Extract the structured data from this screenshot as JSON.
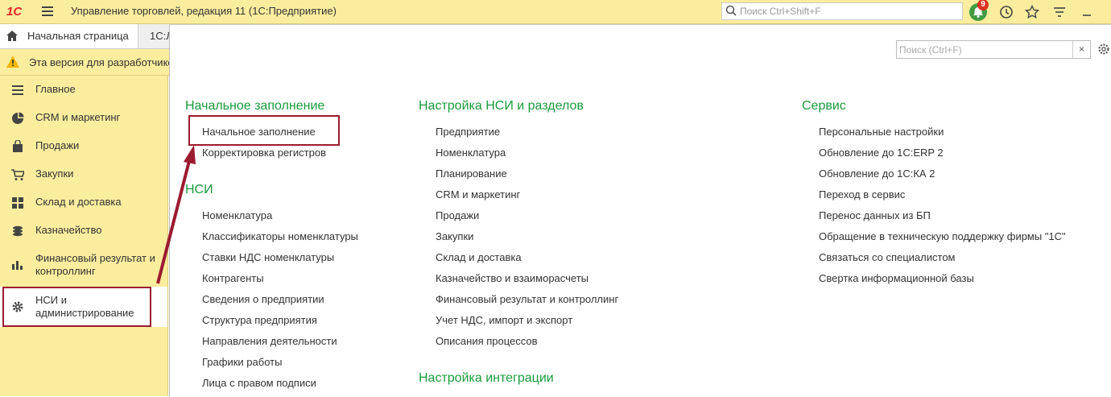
{
  "app": {
    "logo": "1С",
    "title": "Управление торговлей, редакция 11  (1С:Предприятие)",
    "search_placeholder": "Поиск Ctrl+Shift+F",
    "notification_count": "9"
  },
  "tabs": {
    "home": "Начальная страница",
    "next": "1С:Л"
  },
  "warning": "Эта версия для разработчико",
  "sidebar": {
    "items": [
      {
        "label": "Главное",
        "icon": "menu-lines-icon"
      },
      {
        "label": "CRM и маркетинг",
        "icon": "pie-chart-icon"
      },
      {
        "label": "Продажи",
        "icon": "shopping-bag-icon"
      },
      {
        "label": "Закупки",
        "icon": "cart-icon"
      },
      {
        "label": "Склад и доставка",
        "icon": "warehouse-grid-icon"
      },
      {
        "label": "Казначейство",
        "icon": "coins-icon"
      },
      {
        "label": "Финансовый результат и контроллинг",
        "icon": "bar-chart-icon"
      },
      {
        "label": "НСИ и администрирование",
        "icon": "gear-icon"
      }
    ]
  },
  "panel": {
    "search_placeholder": "Поиск (Ctrl+F)",
    "clear": "×",
    "sections": {
      "initial": {
        "title": "Начальное заполнение",
        "links": [
          "Начальное заполнение",
          "Корректировка регистров"
        ]
      },
      "nsi": {
        "title": "НСИ",
        "links": [
          "Номенклатура",
          "Классификаторы номенклатуры",
          "Ставки НДС номенклатуры",
          "Контрагенты",
          "Сведения о предприятии",
          "Структура предприятия",
          "Направления деятельности",
          "Графики работы",
          "Лица с правом подписи"
        ]
      },
      "setup": {
        "title": "Настройка НСИ и разделов",
        "links": [
          "Предприятие",
          "Номенклатура",
          "Планирование",
          "CRM и маркетинг",
          "Продажи",
          "Закупки",
          "Склад и доставка",
          "Казначейство и взаиморасчеты",
          "Финансовый результат и контроллинг",
          "Учет НДС, импорт и экспорт",
          "Описания процессов"
        ]
      },
      "integration": {
        "title": "Настройка интеграции"
      },
      "service": {
        "title": "Сервис",
        "links": [
          "Персональные настройки",
          "Обновление до 1С:ERP 2",
          "Обновление до 1С:КА 2",
          "Переход в сервис",
          "Перенос данных из БП",
          "Обращение в техническую поддержку фирмы \"1С\"",
          "Связаться со специалистом",
          "Свертка информационной базы"
        ]
      }
    }
  },
  "colors": {
    "toolbar_bg": "#fbed9e",
    "section_green": "#1b9b3c",
    "highlight_red": "#9b1b30"
  }
}
